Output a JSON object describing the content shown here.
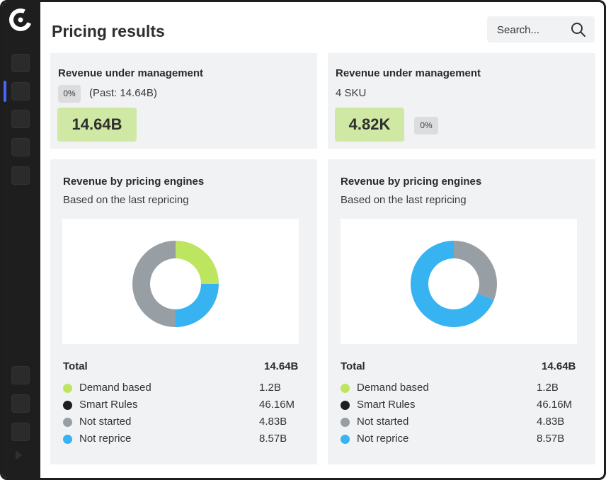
{
  "page": {
    "title": "Pricing results"
  },
  "search": {
    "placeholder": "Search..."
  },
  "colors": {
    "demand_based": "#bde560",
    "smart_rules": "#1e1e1e",
    "not_started": "#979ea4",
    "not_reprice": "#36b3f0",
    "highlight": "#cfe8a4",
    "sidebar": "#1e1e1e",
    "accent": "#4a63ff"
  },
  "cards": {
    "left_summary": {
      "title": "Revenue under management",
      "badge": "0%",
      "past": "(Past: 14.64B)",
      "value": "14.64B"
    },
    "right_summary": {
      "title": "Revenue under management",
      "sku": "4 SKU",
      "value": "4.82K",
      "badge": "0%"
    },
    "left_chart": {
      "title": "Revenue by pricing engines",
      "subtitle": "Based on the last repricing",
      "total_label": "Total",
      "total_value": "14.64B",
      "legend": [
        {
          "label": "Demand based",
          "value": "1.2B"
        },
        {
          "label": "Smart Rules",
          "value": "46.16M"
        },
        {
          "label": "Not started",
          "value": "4.83B"
        },
        {
          "label": "Not reprice",
          "value": "8.57B"
        }
      ]
    },
    "right_chart": {
      "title": "Revenue by pricing engines",
      "subtitle": "Based on the last repricing",
      "total_label": "Total",
      "total_value": "14.64B",
      "legend": [
        {
          "label": "Demand based",
          "value": "1.2B"
        },
        {
          "label": "Smart Rules",
          "value": "46.16M"
        },
        {
          "label": "Not started",
          "value": "4.83B"
        },
        {
          "label": "Not reprice",
          "value": "8.57B"
        }
      ]
    }
  },
  "chart_data": [
    {
      "type": "pie",
      "categories": [
        "Demand based",
        "Not reprice",
        "Not started"
      ],
      "values": [
        0.25,
        0.25,
        0.5
      ],
      "colors": [
        "#bde560",
        "#36b3f0",
        "#979ea4"
      ]
    },
    {
      "type": "pie",
      "categories": [
        "Not started",
        "Not reprice"
      ],
      "values": [
        0.31,
        0.69
      ],
      "colors": [
        "#979ea4",
        "#36b3f0"
      ]
    }
  ]
}
